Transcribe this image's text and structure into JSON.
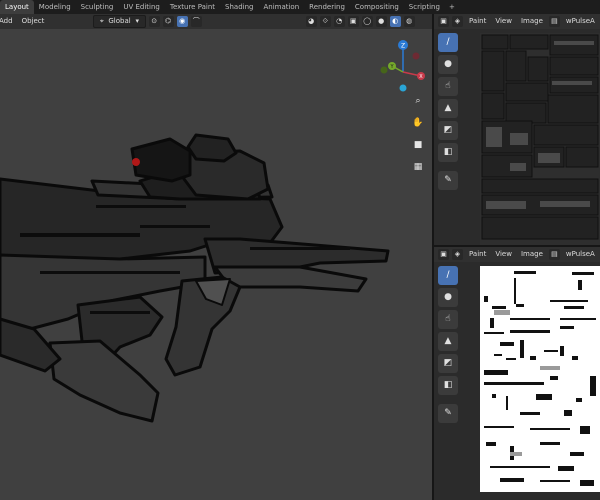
{
  "workspace_tabs": [
    {
      "label": "Layout",
      "active": true
    },
    {
      "label": "Modeling",
      "active": false
    },
    {
      "label": "Sculpting",
      "active": false
    },
    {
      "label": "UV Editing",
      "active": false
    },
    {
      "label": "Texture Paint",
      "active": false
    },
    {
      "label": "Shading",
      "active": false
    },
    {
      "label": "Animation",
      "active": false
    },
    {
      "label": "Rendering",
      "active": false
    },
    {
      "label": "Compositing",
      "active": false
    },
    {
      "label": "Scripting",
      "active": false
    }
  ],
  "workspace_add": "+",
  "viewport": {
    "menu": [
      "Add",
      "Object"
    ],
    "transform_orientation": "Global"
  },
  "gizmo": {
    "axes": {
      "z": "Z",
      "y": "Y",
      "x": "X"
    }
  },
  "image_editor_top": {
    "menu": [
      "Paint",
      "View",
      "Image"
    ],
    "image_name": "wPulseA"
  },
  "image_editor_bottom": {
    "menu": [
      "Paint",
      "View",
      "Image"
    ],
    "image_name": "wPulseA"
  },
  "colors": {
    "accent": "#4772b3",
    "header_bg": "#303030",
    "viewport_bg": "#404040",
    "tab_bar_bg": "#1d1d1d"
  },
  "icons": {
    "editor_type": "image-editor-icon",
    "brush": "brush-icon",
    "soften": "drop-icon",
    "smear": "smear-icon",
    "clone": "stamp-icon",
    "fill": "fill-bucket-icon",
    "mask": "mask-icon",
    "annotate": "annotate-icon"
  }
}
